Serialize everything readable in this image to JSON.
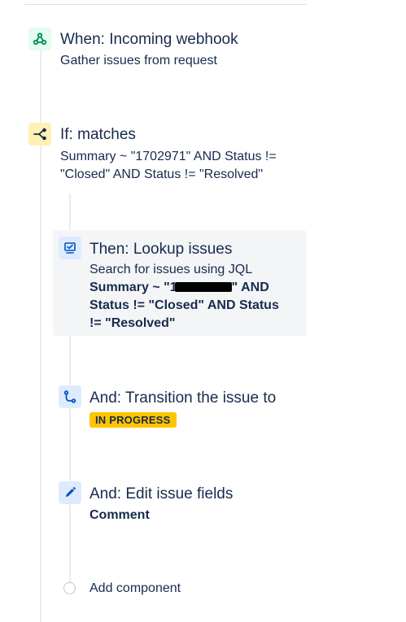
{
  "steps": {
    "trigger": {
      "title": "When: Incoming webhook",
      "subtitle": "Gather issues from request",
      "icon": "webhook-icon"
    },
    "condition": {
      "title": "If: matches",
      "line1": "Summary ~ \"1702971\" AND Status !=",
      "line2": "\"Closed\" AND Status != \"Resolved\"",
      "icon": "branch-icon"
    },
    "lookup": {
      "title": "Then: Lookup issues",
      "subtitle": "Search for issues using JQL",
      "query_line1_start": "Summary ~ \"1",
      "query_line1_end": "\" AND",
      "query_line2": "Status != \"Closed\" AND Status",
      "query_line3": "!= \"Resolved\"",
      "icon": "lookup-issues-icon"
    },
    "transition": {
      "title": "And: Transition the issue to",
      "status": "IN PROGRESS",
      "icon": "transition-icon"
    },
    "edit": {
      "title": "And: Edit issue fields",
      "field": "Comment",
      "icon": "pencil-icon"
    }
  },
  "add_component": {
    "label": "Add component"
  },
  "colors": {
    "trigger_bg": "#e3fcef",
    "trigger_fg": "#00875a",
    "condition_bg": "#fff0b3",
    "condition_fg": "#172b4d",
    "action_bg": "#deebff",
    "action_fg": "#0052cc",
    "lozenge": "#ffc400"
  }
}
